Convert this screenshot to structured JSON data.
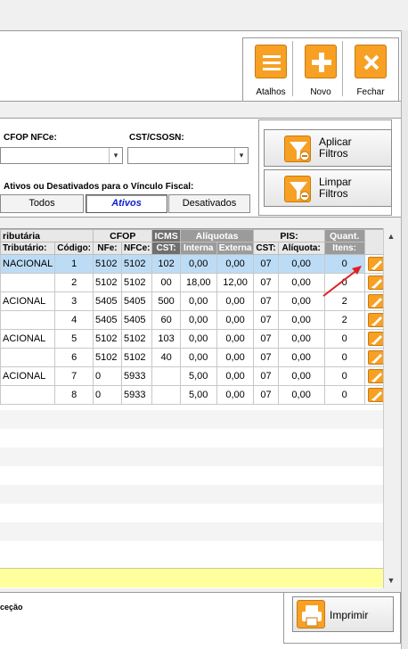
{
  "toolbar": {
    "shortcuts_label": "Atalhos",
    "new_label": "Novo",
    "close_label": "Fechar",
    "accent": "#f7a023"
  },
  "filters": {
    "cfop_nfce_label": "CFOP NFCe:",
    "cst_csosn_label": "CST/CSOSN:",
    "cfop_nfce_value": "",
    "cst_csosn_value": "",
    "active_label": "Ativos ou Desativados para o Vínculo Fiscal:",
    "seg_all": "Todos",
    "seg_active": "Ativos",
    "seg_inactive": "Desativados",
    "apply_line1": "Aplicar",
    "apply_line2": "Filtros",
    "clear_line1": "Limpar",
    "clear_line2": "Filtros"
  },
  "grid": {
    "group_headers": {
      "tributaria": "ributária",
      "cfop": "CFOP",
      "icms": "ICMS",
      "aliquotas": "Alíquotas",
      "pis": "PIS:",
      "quant": "Quant."
    },
    "sub_headers": {
      "tributario": "Tributário:",
      "codigo": "Código:",
      "nfe": "NFe:",
      "nfce": "NFCe:",
      "cst": "CST:",
      "interna": "Interna",
      "externa": "Externa",
      "pis_cst": "CST:",
      "aliquota": "Alíquota:",
      "itens": "Itens:"
    },
    "rows": [
      {
        "regime": "NACIONAL",
        "codigo": "1",
        "nfe": "5102",
        "nfce": "5102",
        "cst": "102",
        "interna": "0,00",
        "externa": "0,00",
        "pis_cst": "07",
        "pis_aliq": "0,00",
        "itens": "0"
      },
      {
        "regime": "",
        "codigo": "2",
        "nfe": "5102",
        "nfce": "5102",
        "cst": "00",
        "interna": "18,00",
        "externa": "12,00",
        "pis_cst": "07",
        "pis_aliq": "0,00",
        "itens": "0"
      },
      {
        "regime": "ACIONAL",
        "codigo": "3",
        "nfe": "5405",
        "nfce": "5405",
        "cst": "500",
        "interna": "0,00",
        "externa": "0,00",
        "pis_cst": "07",
        "pis_aliq": "0,00",
        "itens": "2"
      },
      {
        "regime": "",
        "codigo": "4",
        "nfe": "5405",
        "nfce": "5405",
        "cst": "60",
        "interna": "0,00",
        "externa": "0,00",
        "pis_cst": "07",
        "pis_aliq": "0,00",
        "itens": "2"
      },
      {
        "regime": "ACIONAL",
        "codigo": "5",
        "nfe": "5102",
        "nfce": "5102",
        "cst": "103",
        "interna": "0,00",
        "externa": "0,00",
        "pis_cst": "07",
        "pis_aliq": "0,00",
        "itens": "0"
      },
      {
        "regime": "",
        "codigo": "6",
        "nfe": "5102",
        "nfce": "5102",
        "cst": "40",
        "interna": "0,00",
        "externa": "0,00",
        "pis_cst": "07",
        "pis_aliq": "0,00",
        "itens": "0"
      },
      {
        "regime": "ACIONAL",
        "codigo": "7",
        "nfe": "0",
        "nfce": "5933",
        "cst": "",
        "interna": "5,00",
        "externa": "0,00",
        "pis_cst": "07",
        "pis_aliq": "0,00",
        "itens": "0"
      },
      {
        "regime": "",
        "codigo": "8",
        "nfe": "0",
        "nfce": "5933",
        "cst": "",
        "interna": "5,00",
        "externa": "0,00",
        "pis_cst": "07",
        "pis_aliq": "0,00",
        "itens": "0"
      }
    ]
  },
  "footer": {
    "left_text": "ceção",
    "print_label": "Imprimir"
  }
}
